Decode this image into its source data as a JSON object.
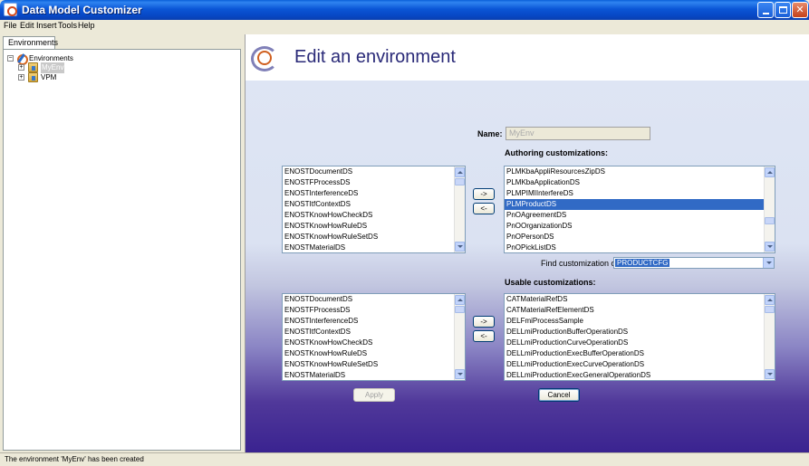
{
  "window": {
    "title": "Data Model Customizer",
    "minimize_label": "",
    "maximize_label": "",
    "close_label": "✕"
  },
  "menu": {
    "items": [
      "File",
      "Edit",
      "Insert",
      "Tools",
      "Help"
    ]
  },
  "left_panel": {
    "tab_label": "Environments",
    "tree": {
      "root_label": "Environments",
      "children": [
        {
          "label": "MyEnv",
          "selected": true
        },
        {
          "label": "VPM",
          "selected": false
        }
      ]
    }
  },
  "main": {
    "title": "Edit an environment",
    "name_label": "Name:",
    "name_value": "MyEnv",
    "authoring_title": "Authoring customizations:",
    "usable_title": "Usable customizations:",
    "available_list": [
      "ENOSTDocumentDS",
      "ENOSTFProcessDS",
      "ENOSTInterferenceDS",
      "ENOSTItfContextDS",
      "ENOSTKnowHowCheckDS",
      "ENOSTKnowHowRuleDS",
      "ENOSTKnowHowRuleSetDS",
      "ENOSTMaterialDS"
    ],
    "authoring_list": [
      "PLMKbaAppliResourcesZipDS",
      "PLMKbaApplicationDS",
      "PLMPIMIInterfereDS",
      "PLMProductDS",
      "PnOAgreementDS",
      "PnOOrganizationDS",
      "PnOPersonDS",
      "PnOPickListDS"
    ],
    "authoring_selected_index": 3,
    "available_list_2": [
      "ENOSTDocumentDS",
      "ENOSTFProcessDS",
      "ENOSTInterferenceDS",
      "ENOSTItfContextDS",
      "ENOSTKnowHowCheckDS",
      "ENOSTKnowHowRuleDS",
      "ENOSTKnowHowRuleSetDS",
      "ENOSTMaterialDS"
    ],
    "usable_list": [
      "CATMaterialRefDS",
      "CATMaterialRefElementDS",
      "DELFmiProcessSample",
      "DELLmiProductionBufferOperationDS",
      "DELLmiProductionCurveOperationDS",
      "DELLmiProductionExecBufferOperationDS",
      "DELLmiProductionExecCurveOperationDS",
      "DELLmiProductionExecGeneralOperationDS"
    ],
    "add_label": "->",
    "remove_label": "<-",
    "find_label": "Find customization of:",
    "find_value": "PRODUCTCFG",
    "apply_label": "Apply",
    "cancel_label": "Cancel"
  },
  "status": {
    "text": "The environment 'MyEnv' has been created"
  },
  "icons": {
    "app": "app-logo-icon",
    "env": "environment-icon",
    "folder": "folder-icon"
  }
}
